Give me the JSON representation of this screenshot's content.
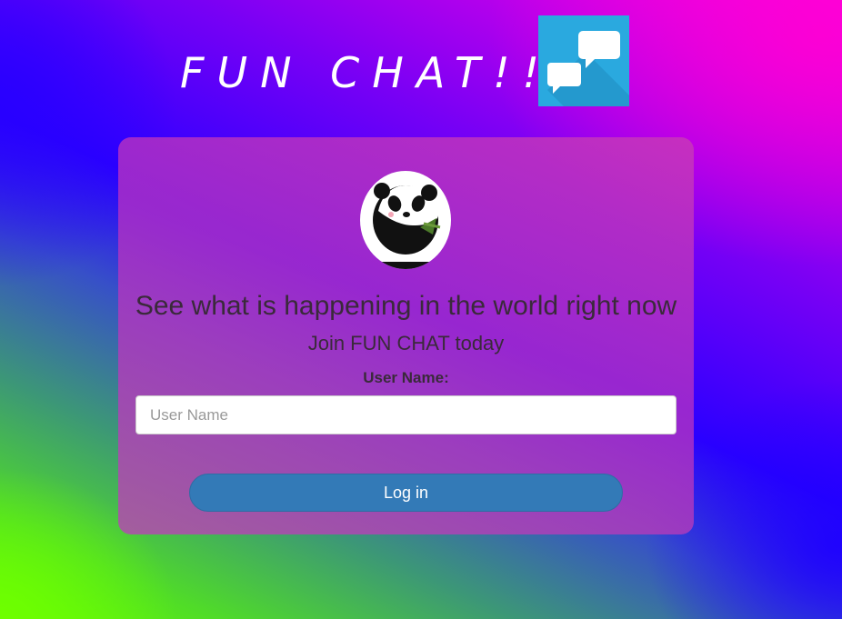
{
  "header": {
    "title": "FUN CHAT!!",
    "logo_icon": "chat-bubbles-icon",
    "logo_color": "#2aa9df"
  },
  "login_card": {
    "avatar_icon": "panda-avatar-icon",
    "headline": "See what is happening in the world right now",
    "subheadline": "Join FUN CHAT today",
    "username_label": "User Name:",
    "username_placeholder": "User Name",
    "username_value": "",
    "login_button_label": "Log in",
    "button_color": "#337ab7"
  }
}
